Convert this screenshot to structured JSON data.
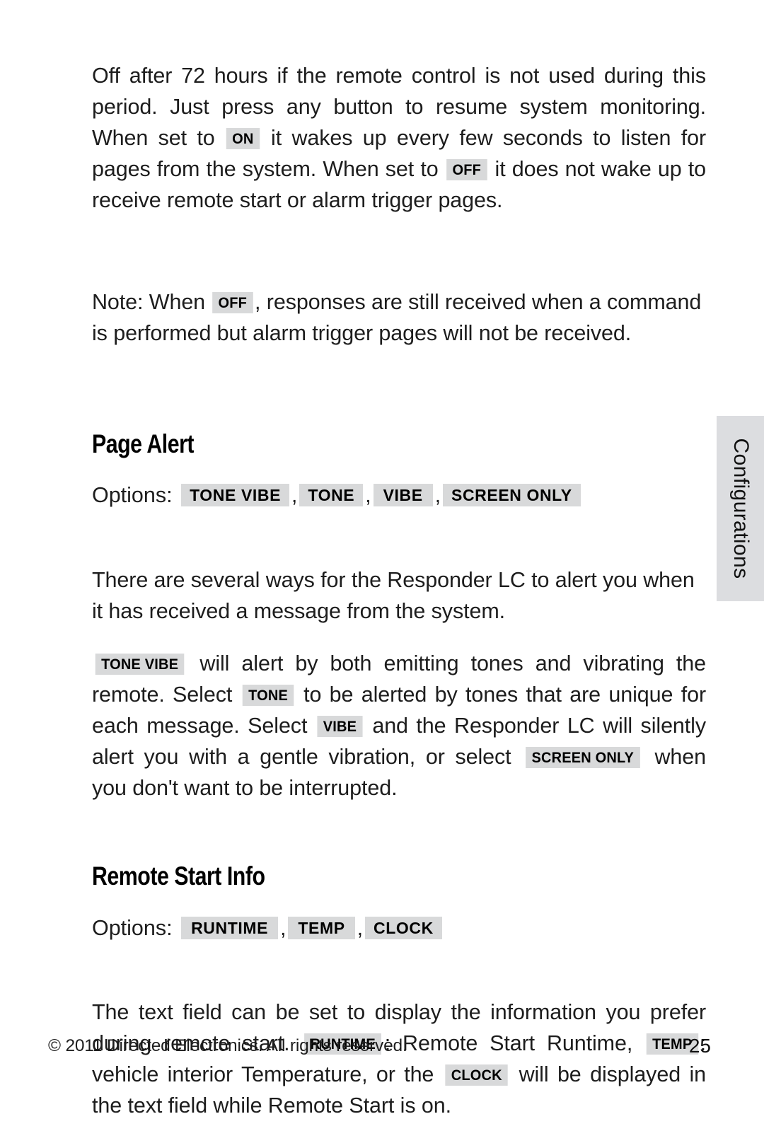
{
  "page": {
    "number": "25",
    "side_tab_label": "Configurations",
    "badge_bg_color": "#d8d9da",
    "side_tab_bg_color": "#dcdde0",
    "text_color": "#1d1d1d"
  },
  "intro": {
    "par1": {
      "seg1": "Off after 72 hours if the remote control is not used during this period. Just press any button to resume system monitoring. When set to",
      "badge1": "ON",
      "seg2": "it wakes up every few seconds to listen for pages from the system. When set to",
      "badge2": "OFF",
      "seg3": "it does not wake up to receive remote start or alarm trigger pages."
    },
    "par2": {
      "seg1": "Note: When",
      "badge1": "OFF",
      "seg2": ", responses are still received when a command is performed but alarm trigger pages will not be received."
    }
  },
  "page_alert": {
    "heading": "Page Alert",
    "options_label": "Options:",
    "options": [
      "TONE VIBE",
      "TONE",
      "VIBE",
      "SCREEN ONLY"
    ],
    "options_separator": ",",
    "par1": "There are several ways for the Responder LC to alert you when it has received a message from the system.",
    "par2": {
      "badge1": "TONE VIBE",
      "seg1": "will alert by both emitting tones and vibrating the remote. Select",
      "badge2": "TONE",
      "seg2": "to be alerted by tones that are unique for each message. Select",
      "badge3": "VIBE",
      "seg3": "and the Responder LC will silently alert you with a gentle vibration, or select",
      "badge4": "SCREEN ONLY",
      "seg4": "when you don't want to be interrupted."
    }
  },
  "remote_start_info": {
    "heading": "Remote Start Info",
    "options_label": "Options:",
    "options": [
      "RUNTIME",
      "TEMP",
      "CLOCK"
    ],
    "options_separator": ",",
    "par1": {
      "seg1": "The text field can be set to display the information you prefer during remote start.",
      "badge1": "RUNTIME",
      "seg2": ": Remote Start Runtime,",
      "badge2": "TEMP",
      "seg3": ": vehicle interior Temperature, or the",
      "badge3": "CLOCK",
      "seg4": "will be displayed in the text field while Remote Start is on."
    }
  },
  "footer": {
    "copyright": "© 2011 Directed Electronics. All rights reserved.",
    "page_number": "25"
  }
}
